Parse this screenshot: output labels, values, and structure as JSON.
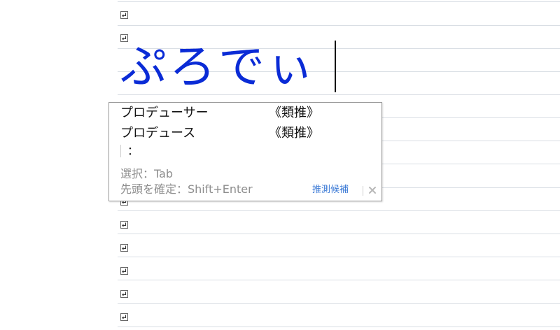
{
  "document": {
    "paragraph_mark_icon": "paragraph-return-icon",
    "line_color": "#d9dee4",
    "ime_input_text": "ぷろでぃ",
    "ime_text_color": "#0a2bd6"
  },
  "ime_popup": {
    "candidates": [
      {
        "word": "プロデューサー",
        "tag": "《類推》"
      },
      {
        "word": "プロデュース",
        "tag": "《類推》"
      }
    ],
    "more_indicator": "：",
    "hint_select": "選択：Tab",
    "hint_confirm": "先頭を確定：Shift+Enter",
    "footer_link": "推測候補",
    "close_icon": "close-icon",
    "link_color": "#3d7bd6"
  }
}
